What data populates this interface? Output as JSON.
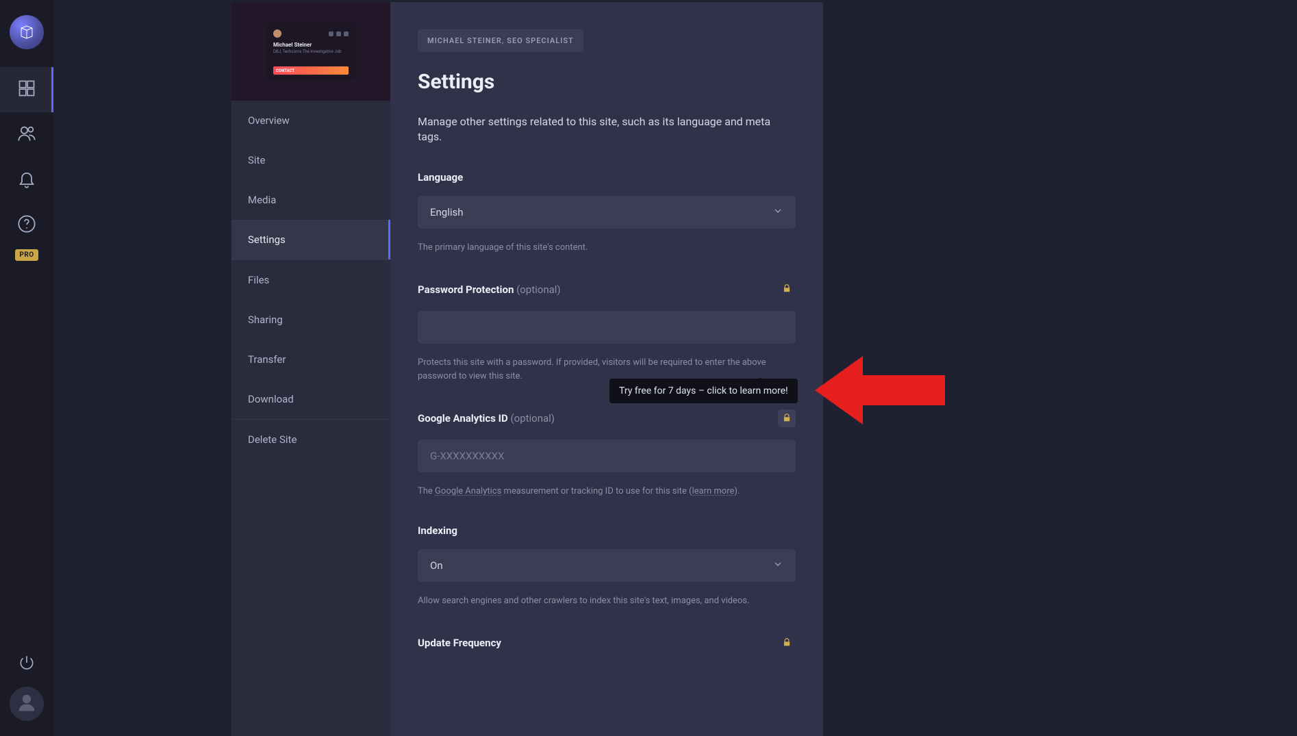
{
  "rail": {
    "pro_badge": "PRO"
  },
  "preview": {
    "name": "Michael Steiner",
    "subtitle": "DBJ, Techcoms The Investigative Job",
    "cta": "CONTACT"
  },
  "sidenav": {
    "items": [
      {
        "label": "Overview"
      },
      {
        "label": "Site"
      },
      {
        "label": "Media"
      },
      {
        "label": "Settings"
      },
      {
        "label": "Files"
      },
      {
        "label": "Sharing"
      },
      {
        "label": "Transfer"
      },
      {
        "label": "Download"
      },
      {
        "label": "Delete Site"
      }
    ]
  },
  "main": {
    "breadcrumb": "MICHAEL STEINER, SEO SPECIALIST",
    "title": "Settings",
    "description": "Manage other settings related to this site, such as its language and meta tags.",
    "language": {
      "label": "Language",
      "value": "English",
      "helper": "The primary language of this site's content."
    },
    "password": {
      "label": "Password Protection",
      "optional": "(optional)",
      "helper": "Protects this site with a password. If provided, visitors will be required to enter the above password to view this site."
    },
    "analytics": {
      "label": "Google Analytics ID",
      "optional": "(optional)",
      "placeholder": "G-XXXXXXXXXX",
      "helper_pre": "The ",
      "helper_link1": "Google Analytics",
      "helper_mid": " measurement or tracking ID to use for this site (",
      "helper_link2": "learn more",
      "helper_post": ")."
    },
    "indexing": {
      "label": "Indexing",
      "value": "On",
      "helper": "Allow search engines and other crawlers to index this site's text, images, and videos."
    },
    "update": {
      "label": "Update Frequency"
    }
  },
  "tooltip": "Try free for 7 days – click to learn more!"
}
